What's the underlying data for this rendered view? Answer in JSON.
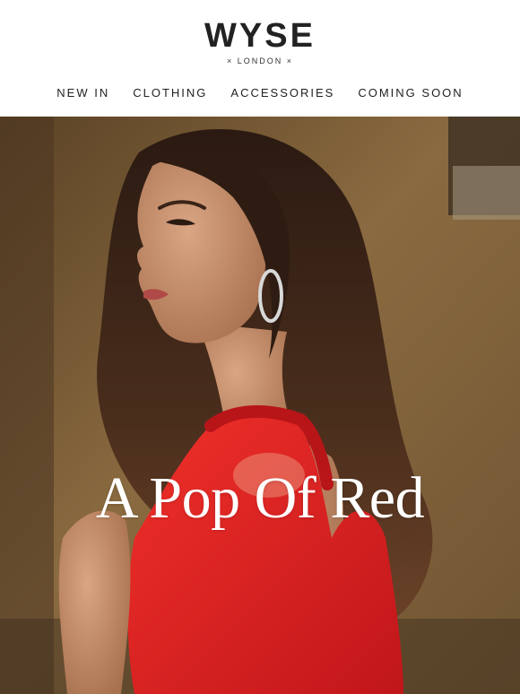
{
  "brand": {
    "name": "WYSE",
    "subtitle": "× LONDON ×"
  },
  "nav": {
    "items": [
      {
        "label": "NEW IN"
      },
      {
        "label": "CLOTHING"
      },
      {
        "label": "ACCESSORIES"
      },
      {
        "label": "COMING SOON"
      }
    ]
  },
  "hero": {
    "headline": "A Pop Of Red",
    "colors": {
      "dress": "#e0221f",
      "wall": "#7a5a34",
      "hair": "#3a2418"
    }
  }
}
